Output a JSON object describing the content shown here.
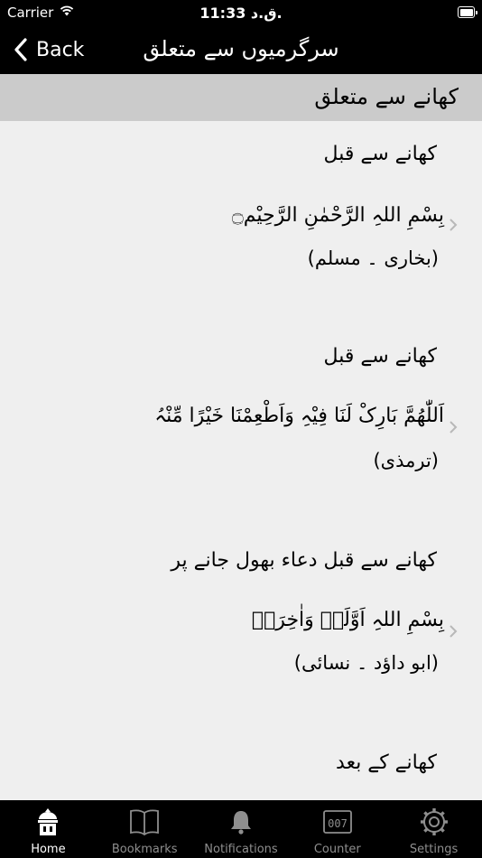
{
  "status_bar": {
    "carrier": "Carrier",
    "time": "11:33 ق.د."
  },
  "nav": {
    "back_label": "Back",
    "title": "سرگرمیوں سے متعلق"
  },
  "section": {
    "title": "کھانے سے متعلق"
  },
  "items": [
    {
      "heading": "کھانے سے قبل",
      "dua": "بِسْمِ اللہِ الرَّحْمٰنِ الرَّحِیْم۝",
      "reference": "(بخاری ۔ مسلم)"
    },
    {
      "heading": "کھانے سے قبل",
      "dua": "اَللّٰھُمَّ بَارِکْ لَنَا فِیْہِ وَاَطْعِمْنَا خَیْرًا مِّنْہُ",
      "reference": "(ترمذی)"
    },
    {
      "heading": "کھانے سے قبل دعاء بھول جانے پر",
      "dua": "بِسْمِ اللہِ اَوَّلَہٗ وَاٰخِرَہٗ",
      "reference": "(ابو داؤد ۔ نسائی)"
    },
    {
      "heading": "کھانے کے بعد"
    }
  ],
  "tabs": [
    {
      "label": "Home",
      "icon": "home-icon",
      "active": true
    },
    {
      "label": "Bookmarks",
      "icon": "book-icon",
      "active": false
    },
    {
      "label": "Notifications",
      "icon": "bell-icon",
      "active": false
    },
    {
      "label": "Counter",
      "icon": "counter-icon",
      "active": false
    },
    {
      "label": "Settings",
      "icon": "gear-icon",
      "active": false
    }
  ],
  "colors": {
    "bar_background": "#000000",
    "section_background": "#cbcbcb",
    "list_background": "#efefef",
    "tab_inactive": "#8e8e8e"
  }
}
